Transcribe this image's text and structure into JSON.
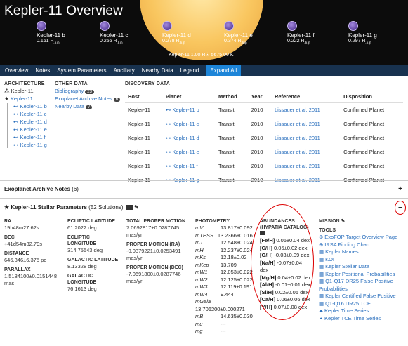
{
  "header": {
    "title": "Kepler-11 Overview",
    "star_label": "Kepler-11 1.00 R☉ 5675.00 K",
    "planets": [
      {
        "name": "Kepler-11 b",
        "radius": "0.161 R",
        "sub": "Jup"
      },
      {
        "name": "Kepler-11 c",
        "radius": "0.256 R",
        "sub": "Jup"
      },
      {
        "name": "Kepler-11 d",
        "radius": "0.278 R",
        "sub": "Jup"
      },
      {
        "name": "Kepler-11 e",
        "radius": "0.374 R",
        "sub": "Jup"
      },
      {
        "name": "Kepler-11 f",
        "radius": "0.222 R",
        "sub": "Jup"
      },
      {
        "name": "Kepler-11 g",
        "radius": "0.297 R",
        "sub": "Jup"
      }
    ]
  },
  "nav": {
    "items": [
      "Overview",
      "Notes",
      "System Parameters",
      "Ancillary",
      "Nearby Data",
      "Legend"
    ],
    "expand": "Expand All"
  },
  "architecture": {
    "title": "ARCHITECTURE",
    "root": "Kepler-11",
    "star": "Kepler-11",
    "planets": [
      "Kepler-11 b",
      "Kepler-11 c",
      "Kepler-11 d",
      "Kepler-11 e",
      "Kepler-11 f",
      "Kepler-11 g"
    ]
  },
  "other_data": {
    "title": "OTHER DATA",
    "items": [
      {
        "label": "Bibliography",
        "count": "23"
      },
      {
        "label": "Exoplanet Archive Notes",
        "count": "6"
      },
      {
        "label": "Nearby Data",
        "count": "7"
      }
    ]
  },
  "discovery": {
    "title": "DISCOVERY DATA",
    "headers": [
      "Host",
      "Planet",
      "Method",
      "Year",
      "Reference",
      "Disposition"
    ],
    "rows": [
      [
        "Kepler-11",
        "Kepler-11 b",
        "Transit",
        "2010",
        "Lissauer et al. 2011",
        "Confirmed Planet"
      ],
      [
        "Kepler-11",
        "Kepler-11 c",
        "Transit",
        "2010",
        "Lissauer et al. 2011",
        "Confirmed Planet"
      ],
      [
        "Kepler-11",
        "Kepler-11 d",
        "Transit",
        "2010",
        "Lissauer et al. 2011",
        "Confirmed Planet"
      ],
      [
        "Kepler-11",
        "Kepler-11 e",
        "Transit",
        "2010",
        "Lissauer et al. 2011",
        "Confirmed Planet"
      ],
      [
        "Kepler-11",
        "Kepler-11 f",
        "Transit",
        "2010",
        "Lissauer et al. 2011",
        "Confirmed Planet"
      ],
      [
        "Kepler-11",
        "Kepler-11 g",
        "Transit",
        "2010",
        "Lissauer et al. 2011",
        "Confirmed Planet"
      ]
    ]
  },
  "notes": {
    "title": "Exoplanet Archive Notes",
    "count": "(6)",
    "toggle": "+"
  },
  "params": {
    "title": "Kepler-11 Stellar Parameters",
    "solutions": "(52 Solutions)",
    "toggle": "−",
    "position": [
      {
        "label": "RA",
        "value": "19h48m27.62s"
      },
      {
        "label": "DEC",
        "value": "+41d54m32.79s"
      },
      {
        "label": "DISTANCE",
        "value": "646.346±6.375 pc"
      },
      {
        "label": "PARALLAX",
        "value": "1.5184100±0.0151448 mas"
      }
    ],
    "ecliptic": [
      {
        "label": "ECLIPTIC LATITUDE",
        "value": "61.2022 deg"
      },
      {
        "label": "ECLIPTIC LONGITUDE",
        "value": "314.75543 deg"
      },
      {
        "label": "GALACTIC LATITUDE",
        "value": "8.13328 deg"
      },
      {
        "label": "GALACTIC LONGITUDE",
        "value": "76.1613 deg"
      }
    ],
    "motion": [
      {
        "label": "TOTAL PROPER MOTION",
        "value": "7.0692817±0.0287745 mas/yr"
      },
      {
        "label": "PROPER MOTION (RA)",
        "value": "-0.0379221±0.0253491 mas/yr"
      },
      {
        "label": "PROPER MOTION (DEC)",
        "value": "-7.0691800±0.0287746 mas/yr"
      }
    ],
    "photometry": {
      "title": "PHOTOMETRY",
      "rows": [
        {
          "k": "mV",
          "v": "13.817±0.092"
        },
        {
          "k": "mTESS",
          "v": "13.2366±0.0167"
        },
        {
          "k": "mJ",
          "v": "12.548±0.024"
        },
        {
          "k": "mH",
          "v": "12.237±0.024"
        },
        {
          "k": "mKs",
          "v": "12.18±0.02"
        },
        {
          "k": "mKep",
          "v": "13.709"
        },
        {
          "k": "mW1",
          "v": "12.053±0.022"
        },
        {
          "k": "mW2",
          "v": "12.125±0.022"
        },
        {
          "k": "mW3",
          "v": "12.119±0.191"
        },
        {
          "k": "mW4",
          "v": "9.444"
        },
        {
          "k": "mGaia",
          "v": "13.706200±0.000271"
        },
        {
          "k": "mB",
          "v": "14.635±0.030"
        },
        {
          "k": "mu",
          "v": "---"
        },
        {
          "k": "mg",
          "v": "---"
        }
      ]
    },
    "abundances": {
      "title": "ABUNDANCES (HYPATIA CATALOG)",
      "rows": [
        {
          "k": "[Fe/H]",
          "v": "0.06±0.04 dex"
        },
        {
          "k": "[C/H]",
          "v": "0.05±0.02 dex"
        },
        {
          "k": "[O/H]",
          "v": "-0.03±0.09 dex"
        },
        {
          "k": "[Na/H]",
          "v": "-0.07±0.04 dex"
        },
        {
          "k": "[Mg/H]",
          "v": "0.04±0.02 dex"
        },
        {
          "k": "[Al/H]",
          "v": "-0.01±0.01 dex"
        },
        {
          "k": "[Si/H]",
          "v": "0.02±0.05 dex"
        },
        {
          "k": "[Ca/H]",
          "v": "0.06±0.06 dex"
        },
        {
          "k": "[Y/H]",
          "v": "0.07±0.08 dex"
        }
      ]
    },
    "mission": {
      "title": "MISSION",
      "tools_title": "TOOLS",
      "tools": [
        "ExoFOP Target Overview Page",
        "IRSA Finding Chart",
        "Kepler Names",
        "KOI",
        "Kepler Stellar Data",
        "Kepler Positional Probabilities",
        "Q1-Q17 DR25 False Positive Probabilities",
        "Kepler Certified False Positive",
        "Q1-Q16 DR25 TCE",
        "Kepler Time Series",
        "Kepler TCE Time Series"
      ]
    }
  },
  "colors": {
    "nav_bg": "#18324f",
    "accent": "#1d85d8",
    "link": "#2a6fbd",
    "highlight": "#dd0000"
  }
}
